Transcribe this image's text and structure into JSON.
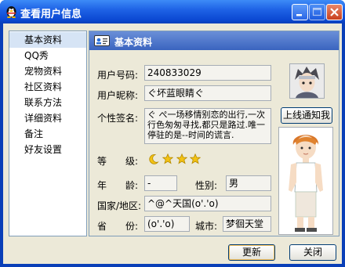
{
  "window": {
    "title": "查看用户信息"
  },
  "sidebar": {
    "items": [
      {
        "label": "基本资料"
      },
      {
        "label": "QQ秀"
      },
      {
        "label": "宠物资料"
      },
      {
        "label": "社区资料"
      },
      {
        "label": "联系方法"
      },
      {
        "label": "详细资料"
      },
      {
        "label": "备注"
      },
      {
        "label": "好友设置"
      }
    ]
  },
  "panel": {
    "title": "基本资料",
    "user_id_label": "用户号码:",
    "user_id_value": "240833029",
    "nickname_label": "用户昵称:",
    "nickname_value": "ぐ坏蓝眼睛ぐ",
    "signature_label": "个性签名:",
    "signature_value": "ぐ ぺ一场移情别恋的出行,一次行色匆匆寻找,都只是路过.唯一停驻的是--时间的谎言.",
    "level_label": "等　　级:",
    "age_label": "年　　龄:",
    "age_value": "-",
    "gender_label": "性别:",
    "gender_value": "男",
    "country_label": "国家/地区:",
    "country_value": "^@^天国(o'.'o)",
    "province_label": "省　　份:",
    "province_value": "(o'.'o)",
    "city_label": "城市:",
    "city_value": "梦徊天堂",
    "notify_button": "上线通知我"
  },
  "footer": {
    "refresh_button": "更新",
    "close_button": "关闭"
  },
  "level": {
    "moons": 1,
    "stars": 3
  }
}
